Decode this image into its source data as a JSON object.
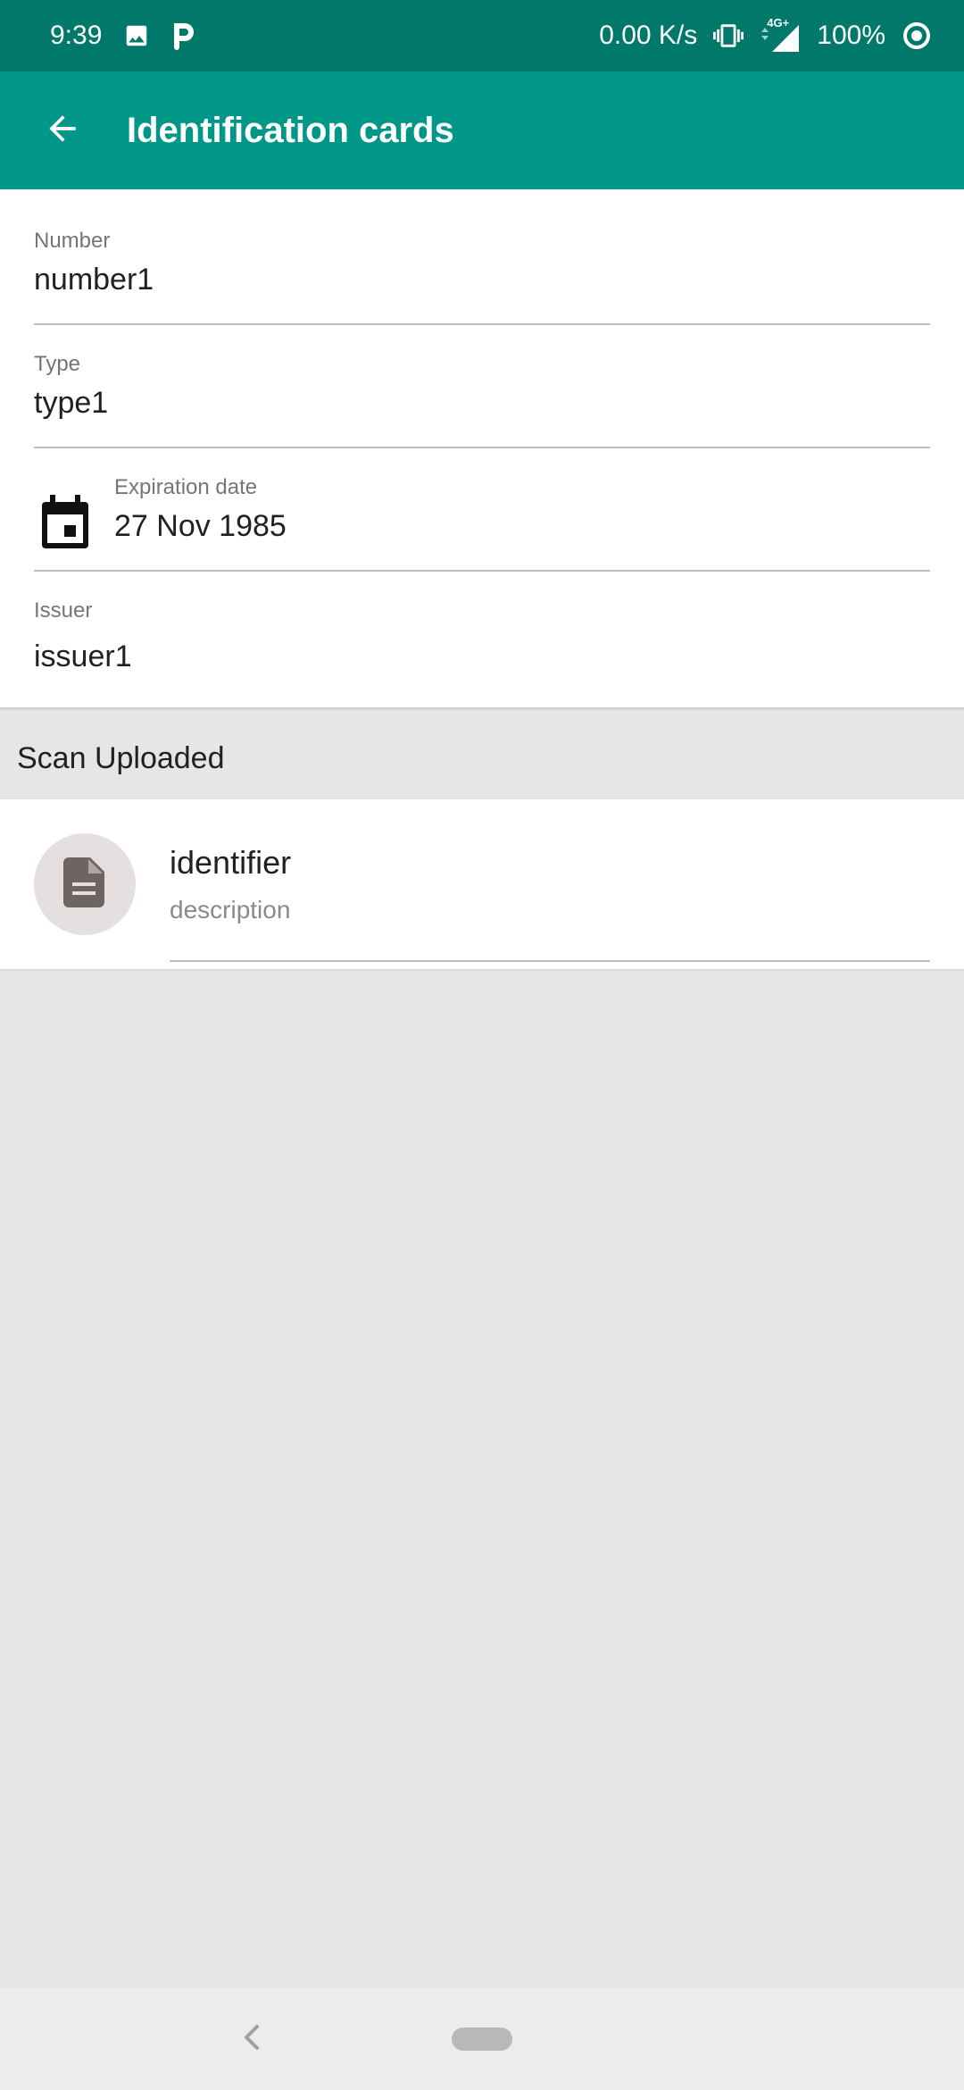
{
  "status_bar": {
    "time": "9:39",
    "speed": "0.00 K/s",
    "network": "4G+",
    "battery": "100%",
    "icons": [
      "image-icon",
      "p-app-icon",
      "vibrate-icon",
      "signal-icon",
      "sync-icon"
    ]
  },
  "app_bar": {
    "title": "Identification cards",
    "back_icon": "arrow-back-icon"
  },
  "form": {
    "number": {
      "label": "Number",
      "value": "number1"
    },
    "type": {
      "label": "Type",
      "value": "type1"
    },
    "expiration": {
      "label": "Expiration date",
      "value": "27 Nov 1985",
      "icon": "calendar-icon"
    },
    "issuer": {
      "label": "Issuer",
      "value": "issuer1"
    }
  },
  "scan_section": {
    "header": "Scan Uploaded",
    "items": [
      {
        "identifier": "identifier",
        "description": "description",
        "icon": "document-icon"
      }
    ]
  },
  "colors": {
    "status_bar": "#00796b",
    "app_bar": "#009688",
    "background": "#e6e6e6"
  }
}
